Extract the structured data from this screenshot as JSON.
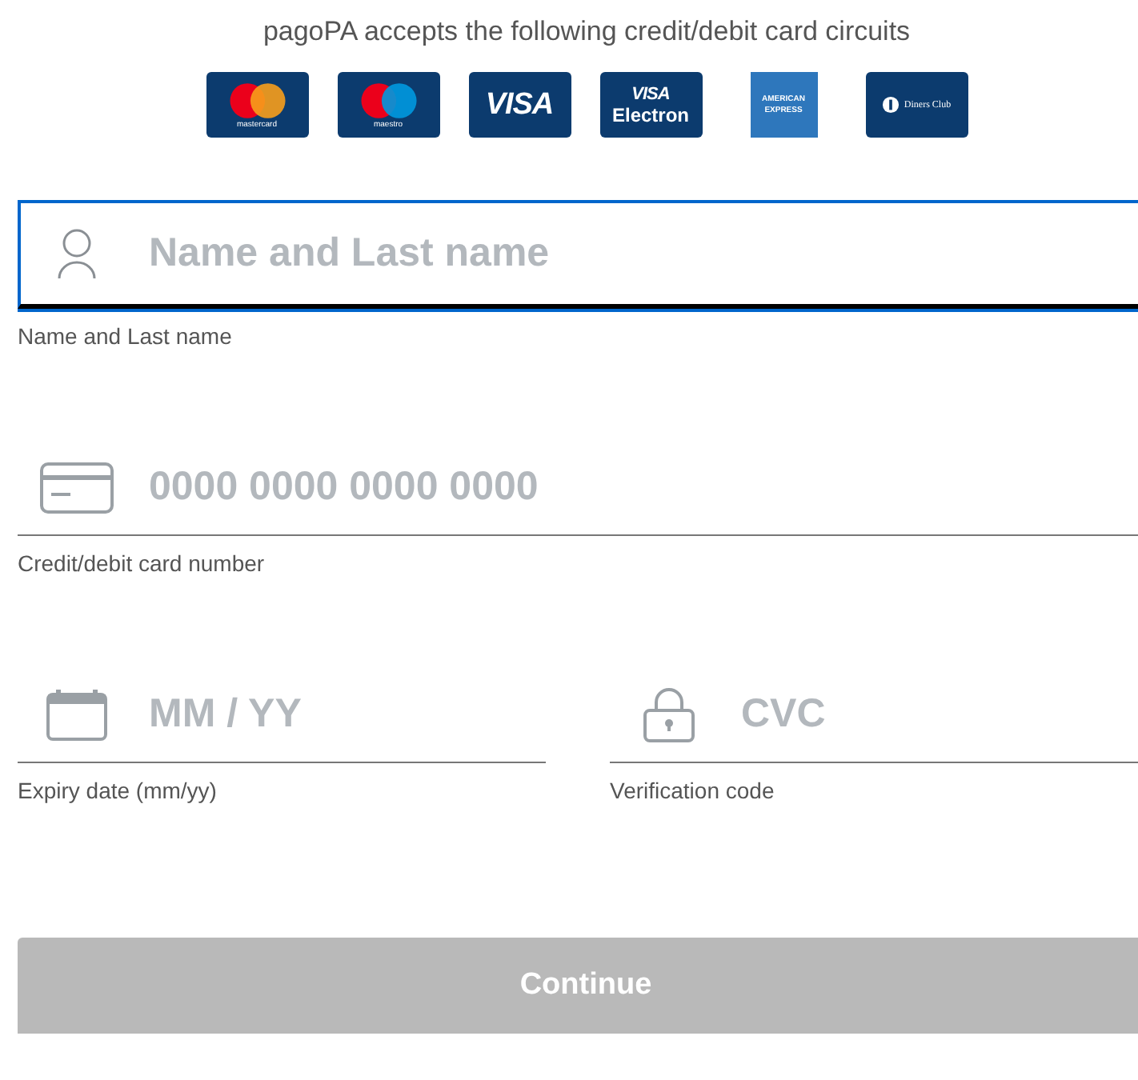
{
  "header": {
    "text": "pagoPA accepts the following credit/debit card circuits"
  },
  "cards": [
    {
      "kind": "mastercard",
      "label": "mastercard"
    },
    {
      "kind": "maestro",
      "label": "maestro"
    },
    {
      "kind": "visa",
      "label": "VISA"
    },
    {
      "kind": "electron",
      "label": "VISA",
      "sublabel": "Electron"
    },
    {
      "kind": "amex",
      "label": "AMERICAN",
      "sublabel": "EXPRESS"
    },
    {
      "kind": "diners",
      "label": "Diners Club"
    }
  ],
  "rows": [
    [
      {
        "kind": "person",
        "placeholder": "Name and Last name",
        "label": "Name and Last name",
        "focused": true
      }
    ],
    [
      {
        "kind": "card",
        "placeholder": "0000 0000 0000 0000",
        "label": "Credit/debit card number",
        "focused": false
      }
    ],
    [
      {
        "kind": "calendar",
        "placeholder": "MM / YY",
        "label": "Expiry date (mm/yy)",
        "focused": false
      },
      {
        "kind": "lock",
        "placeholder": "CVC",
        "label": "Verification code",
        "focused": false
      }
    ]
  ],
  "button": {
    "label": "Continue",
    "disabled": true
  }
}
